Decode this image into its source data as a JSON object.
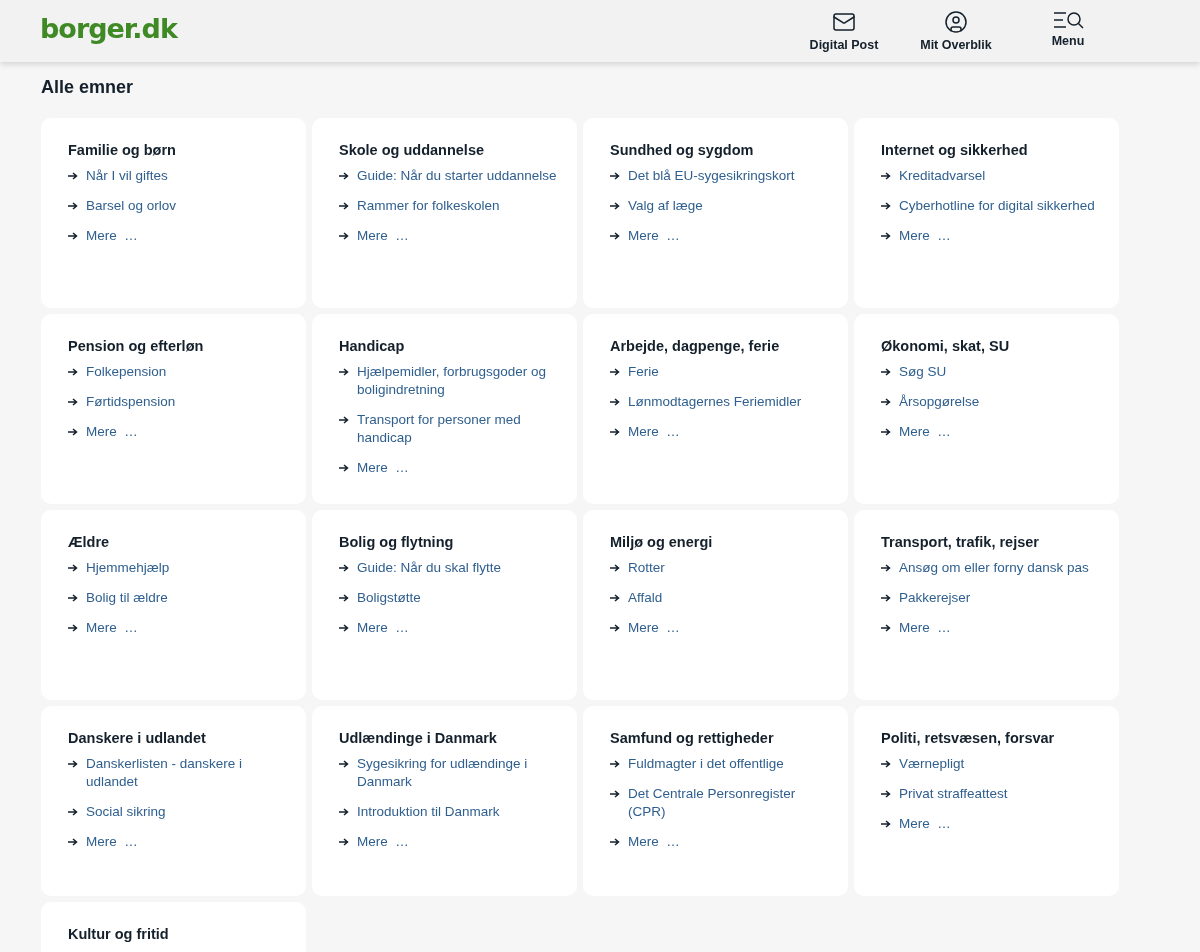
{
  "header": {
    "logo": "borger.dk",
    "nav": [
      {
        "kind": "mail",
        "label": "Digital Post"
      },
      {
        "kind": "user",
        "label": "Mit Overblik"
      },
      {
        "kind": "menu",
        "label": "Menu"
      }
    ]
  },
  "page_title": "Alle emner",
  "topics": [
    {
      "title": "Familie og børn",
      "links": [
        "Når I vil giftes",
        "Barsel og orlov",
        "Mere  …"
      ]
    },
    {
      "title": "Skole og uddannelse",
      "links": [
        "Guide: Når du starter uddannelse",
        "Rammer for folkeskolen",
        "Mere  …"
      ]
    },
    {
      "title": "Sundhed og sygdom",
      "links": [
        "Det blå EU-sygesikringskort",
        "Valg af læge",
        "Mere  …"
      ]
    },
    {
      "title": "Internet og sikkerhed",
      "links": [
        "Kreditadvarsel",
        "Cyberhotline for digital sikkerhed",
        "Mere  …"
      ]
    },
    {
      "title": "Pension og efterløn",
      "links": [
        "Folkepension",
        "Førtidspension",
        "Mere  …"
      ]
    },
    {
      "title": "Handicap",
      "links": [
        "Hjælpemidler, forbrugsgoder og boligindretning",
        "Transport for personer med handicap",
        "Mere  …"
      ]
    },
    {
      "title": "Arbejde, dagpenge, ferie",
      "links": [
        "Ferie",
        "Lønmodtagernes Feriemidler",
        "Mere  …"
      ]
    },
    {
      "title": "Økonomi, skat, SU",
      "links": [
        "Søg SU",
        "Årsopgørelse",
        "Mere  …"
      ]
    },
    {
      "title": "Ældre",
      "links": [
        "Hjemmehjælp",
        "Bolig til ældre",
        "Mere  …"
      ]
    },
    {
      "title": "Bolig og flytning",
      "links": [
        "Guide: Når du skal flytte",
        "Boligstøtte",
        "Mere  …"
      ]
    },
    {
      "title": "Miljø og energi",
      "links": [
        "Rotter",
        "Affald",
        "Mere  …"
      ]
    },
    {
      "title": "Transport, trafik, rejser",
      "links": [
        "Ansøg om eller forny dansk pas",
        "Pakkerejser",
        "Mere  …"
      ]
    },
    {
      "title": "Danskere i udlandet",
      "links": [
        "Danskerlisten - danskere i udlandet",
        "Social sikring",
        "Mere  …"
      ]
    },
    {
      "title": "Udlændinge i Danmark",
      "links": [
        "Sygesikring for udlændinge i Danmark",
        "Introduktion til Danmark",
        "Mere  …"
      ]
    },
    {
      "title": "Samfund og rettigheder",
      "links": [
        "Fuldmagter i det offentlige",
        "Det Centrale Personregister (CPR)",
        "Mere  …"
      ]
    },
    {
      "title": "Politi, retsvæsen, forsvar",
      "links": [
        "Værnepligt",
        "Privat straffeattest",
        "Mere  …"
      ]
    },
    {
      "title": "Kultur og fritid"
    }
  ]
}
